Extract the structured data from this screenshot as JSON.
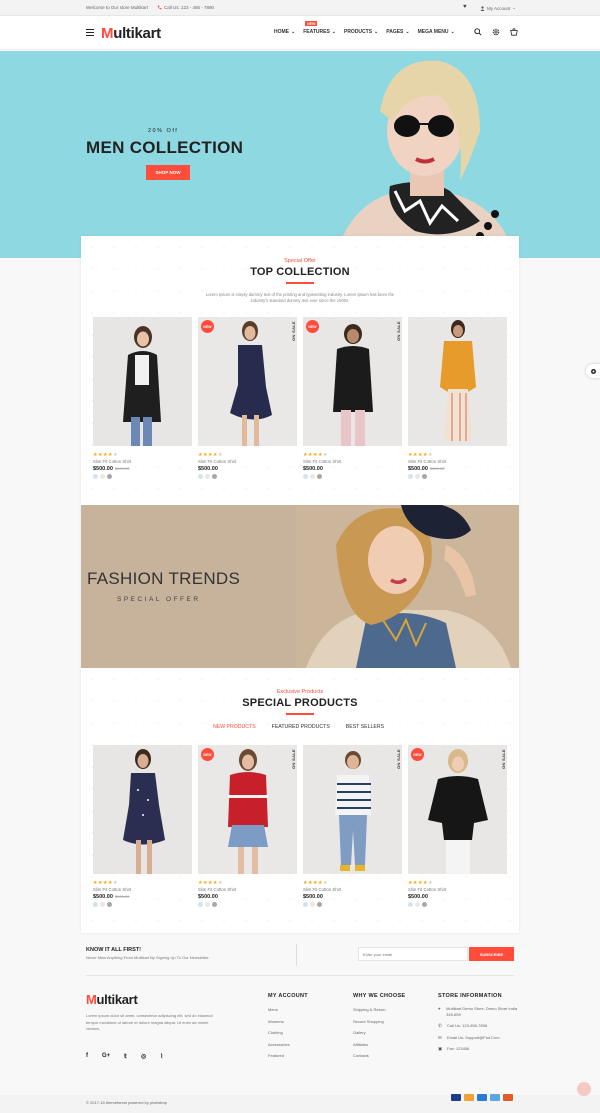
{
  "colors": {
    "accent": "#ff4c3b",
    "hero_bg": "#8ed8e2",
    "star": "#ffa200"
  },
  "topbar": {
    "welcome": "Welcome to Our store Multikart",
    "call": "Call Us: 123 - 456 - 7890",
    "account": "My Account"
  },
  "header": {
    "logo_m": "M",
    "logo_rest": "ultikart",
    "new_tag": "NEW",
    "nav": [
      "HOME",
      "FEATURES",
      "PRODUCTS",
      "PAGES",
      "MEGA MENU"
    ]
  },
  "hero": {
    "offer": "20% Off",
    "title": "MEN COLLECTION",
    "button": "SHOP NOW"
  },
  "top_collection": {
    "sub": "Special Offer",
    "title": "TOP COLLECTION",
    "desc": "Lorem Ipsum is simply dummy text of the printing and typesetting industry. Lorem Ipsum has been the industry's standard dummy text ever since the 1500s."
  },
  "products_top": [
    {
      "name": "Slim Fit Cotton Shirt",
      "price": "$500.00",
      "old": "$600.00",
      "rating": 4,
      "badge_new": "",
      "on_sale": ""
    },
    {
      "name": "Slim Fit Cotton Shirt",
      "price": "$500.00",
      "old": "",
      "rating": 4,
      "badge_new": "NEW",
      "on_sale": "ON SALE"
    },
    {
      "name": "Slim Fit Cotton Shirt",
      "price": "$500.00",
      "old": "",
      "rating": 4,
      "badge_new": "NEW",
      "on_sale": "ON SALE"
    },
    {
      "name": "Slim Fit Cotton Shirt",
      "price": "$500.00",
      "old": "$600.00",
      "rating": 4,
      "badge_new": "",
      "on_sale": ""
    }
  ],
  "banner": {
    "title": "FASHION TRENDS",
    "subtitle": "SPECIAL OFFER"
  },
  "special": {
    "sub": "Exclusive Products",
    "title": "SPECIAL PRODUCTS",
    "tabs": [
      "NEW PRODUCTS",
      "FEATURED PRODUCTS",
      "BEST SELLERS"
    ]
  },
  "products_special": [
    {
      "name": "Slim Fit Cotton Shirt",
      "price": "$500.00",
      "old": "$600.00",
      "rating": 4,
      "badge_new": "",
      "on_sale": ""
    },
    {
      "name": "Slim Fit Cotton Shirt",
      "price": "$500.00",
      "old": "",
      "rating": 4,
      "badge_new": "NEW",
      "on_sale": "ON SALE"
    },
    {
      "name": "Slim Fit Cotton Shirt",
      "price": "$500.00",
      "old": "",
      "rating": 4,
      "badge_new": "",
      "on_sale": "ON SALE"
    },
    {
      "name": "Slim Fit Cotton Shirt",
      "price": "$500.00",
      "old": "",
      "rating": 4,
      "badge_new": "NEW",
      "on_sale": "ON SALE"
    }
  ],
  "newsletter": {
    "heading": "KNOW IT ALL FIRST!",
    "text": "Never Miss Anything From Multikart By Signing Up To Our Newsletter.",
    "placeholder": "Enter your email",
    "button": "SUBSCRIBE"
  },
  "footer": {
    "logo_m": "M",
    "logo_rest": "ultikart",
    "desc": "Lorem ipsum dolor sit amet, consectetur adipiscing elit, sed do eiusmod tempor incididunt ut labore et dolore magna aliqua. Ut enim ad minim veniam,",
    "my_account": {
      "heading": "MY ACCOUNT",
      "links": [
        "Mens",
        "Womens",
        "Clothing",
        "Accessories",
        "Featured"
      ]
    },
    "why": {
      "heading": "WHY WE CHOOSE",
      "links": [
        "Shipping & Return",
        "Secure Shopping",
        "Gallery",
        "Affiliates",
        "Contacts"
      ]
    },
    "store": {
      "heading": "STORE INFORMATION",
      "address": "Multikart Demo Store, Demo Store India 345-659",
      "call": "Call Us: 123-456-7898",
      "email": "Email Us: Support@Fiot.Com",
      "fax": "Fax: 123456"
    },
    "copyright": "© 2017-18 themeforest powered by pixelstrap"
  }
}
